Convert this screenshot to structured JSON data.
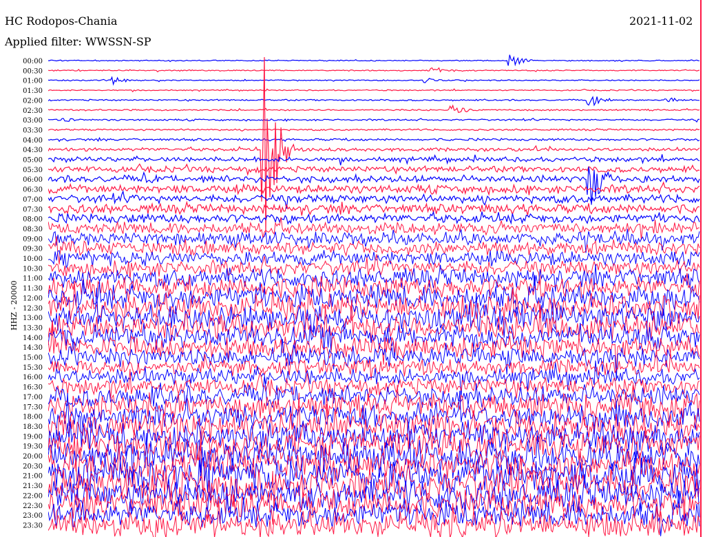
{
  "header": {
    "station": "HC Rodopos-Chania",
    "filter": "Applied filter: WWSSN-SP",
    "date": "2021-11-02"
  },
  "channel_label": "HHZ - 20000",
  "colors": {
    "even_rows": "#0000ff",
    "odd_rows": "#ff1744",
    "background": "#ffffff",
    "text": "#000000"
  },
  "chart_data": {
    "type": "line",
    "title": "HC Rodopos-Chania",
    "subtitle": "Applied filter: WWSSN-SP",
    "ylabel": "HHZ - 20000",
    "rows": [
      "00:00",
      "00:30",
      "01:00",
      "01:30",
      "02:00",
      "02:30",
      "03:00",
      "03:30",
      "04:00",
      "04:30",
      "05:00",
      "05:30",
      "06:00",
      "06:30",
      "07:00",
      "07:30",
      "08:00",
      "08:30",
      "09:00",
      "09:30",
      "10:00",
      "10:30",
      "11:00",
      "11:30",
      "12:00",
      "12:30",
      "13:00",
      "13:30",
      "14:00",
      "14:30",
      "15:00",
      "15:30",
      "16:00",
      "16:30",
      "17:00",
      "17:30",
      "18:00",
      "18:30",
      "19:00",
      "19:30",
      "20:00",
      "20:30",
      "21:00",
      "21:30",
      "22:00",
      "22:30",
      "23:00",
      "23:30"
    ],
    "row_noise_amplitude": [
      1,
      1,
      1,
      1,
      1.3,
      1.3,
      1.5,
      1.5,
      2,
      3,
      4,
      5,
      6,
      7,
      7,
      8,
      8,
      10,
      11,
      12,
      12,
      13,
      16,
      18,
      20,
      22,
      22,
      22,
      20,
      18,
      16,
      14,
      14,
      14,
      18,
      20,
      22,
      24,
      24,
      24,
      26,
      26,
      28,
      28,
      26,
      24,
      22,
      22
    ],
    "events": [
      {
        "row": "00:00",
        "x_frac": 0.71,
        "amplitude": 12
      },
      {
        "row": "00:30",
        "x_frac": 0.59,
        "amplitude": 10
      },
      {
        "row": "01:00",
        "x_frac": 0.1,
        "amplitude": 8
      },
      {
        "row": "01:00",
        "x_frac": 0.58,
        "amplitude": 6
      },
      {
        "row": "02:00",
        "x_frac": 0.83,
        "amplitude": 14
      },
      {
        "row": "02:00",
        "x_frac": 0.95,
        "amplitude": 6
      },
      {
        "row": "02:30",
        "x_frac": 0.62,
        "amplitude": 12
      },
      {
        "row": "03:00",
        "x_frac": 0.02,
        "amplitude": 8
      },
      {
        "row": "04:30",
        "x_frac": 0.33,
        "amplitude": 200
      },
      {
        "row": "06:00",
        "x_frac": 0.83,
        "amplitude": 90
      },
      {
        "row": "08:30",
        "x_frac": 0.54,
        "amplitude": 20
      }
    ]
  }
}
